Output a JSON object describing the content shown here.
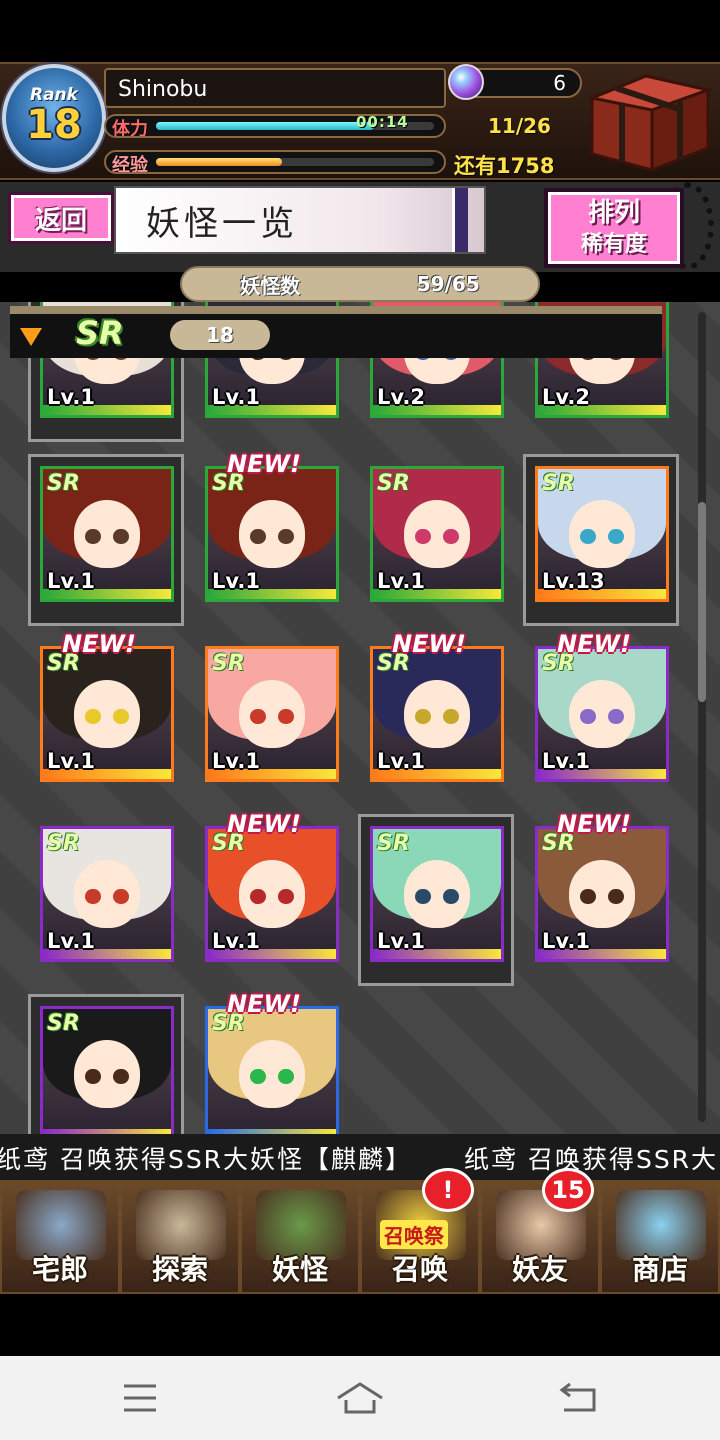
{
  "player": {
    "rank_label": "Rank",
    "rank": "18",
    "name": "Shinobu",
    "stamina_label": "体力",
    "stamina_timer": "00:14",
    "stamina_fill": 0.78,
    "stamina_count": "11/26",
    "xp_label": "经验",
    "xp_fill": 0.45,
    "xp_remaining": "还有1758",
    "gems": "6"
  },
  "titlebar": {
    "back_label": "返回",
    "title": "妖怪一览",
    "sort_label": "排列",
    "sort_value": "稀有度"
  },
  "yokai_count": {
    "label": "妖怪数",
    "value": "59/65"
  },
  "section": {
    "rarity": "SR",
    "count": "18"
  },
  "cards": [
    {
      "level": "Lv.1",
      "new": false,
      "sr": false,
      "framed": true,
      "rarity_color": "#2aa83a",
      "hair": "#e8e0d8",
      "eye": "#6a4a2a"
    },
    {
      "level": "Lv.1",
      "new": false,
      "sr": false,
      "framed": false,
      "rarity_color": "#2aa83a",
      "hair": "#2a2a3a",
      "eye": "#3a2a1a"
    },
    {
      "level": "Lv.2",
      "new": false,
      "sr": false,
      "framed": false,
      "rarity_color": "#2aa83a",
      "hair": "#e05a6a",
      "eye": "#3a6aaa"
    },
    {
      "level": "Lv.2",
      "new": false,
      "sr": false,
      "framed": false,
      "rarity_color": "#2aa83a",
      "hair": "#8a2a2a",
      "eye": "#4a2a1a"
    },
    {
      "level": "Lv.1",
      "new": false,
      "sr": true,
      "framed": true,
      "rarity_color": "#2aa83a",
      "hair": "#7a2418",
      "eye": "#5a3a2a"
    },
    {
      "level": "Lv.1",
      "new": true,
      "sr": true,
      "framed": false,
      "rarity_color": "#2aa83a",
      "hair": "#7a2418",
      "eye": "#5a3a2a"
    },
    {
      "level": "Lv.1",
      "new": false,
      "sr": true,
      "framed": false,
      "rarity_color": "#2aa83a",
      "hair": "#b02a4a",
      "eye": "#d03a6a"
    },
    {
      "level": "Lv.13",
      "new": false,
      "sr": true,
      "framed": true,
      "rarity_color": "#ff7a1a",
      "hair": "#c8d8ec",
      "eye": "#3aa8c8"
    },
    {
      "level": "Lv.1",
      "new": true,
      "sr": true,
      "framed": false,
      "rarity_color": "#ff7a1a",
      "hair": "#2a221c",
      "eye": "#e8c82a"
    },
    {
      "level": "Lv.1",
      "new": false,
      "sr": true,
      "framed": false,
      "rarity_color": "#ff7a1a",
      "hair": "#f8a8a0",
      "eye": "#c83a2a"
    },
    {
      "level": "Lv.1",
      "new": true,
      "sr": true,
      "framed": false,
      "rarity_color": "#ff7a1a",
      "hair": "#2a2a5a",
      "eye": "#c8a82a"
    },
    {
      "level": "Lv.1",
      "new": true,
      "sr": true,
      "framed": false,
      "rarity_color": "#8a2ac8",
      "hair": "#a8d8c8",
      "eye": "#8a6ac8"
    },
    {
      "level": "Lv.1",
      "new": false,
      "sr": true,
      "framed": false,
      "rarity_color": "#8a2ac8",
      "hair": "#e8e4e0",
      "eye": "#c83a2a"
    },
    {
      "level": "Lv.1",
      "new": true,
      "sr": true,
      "framed": false,
      "rarity_color": "#8a2ac8",
      "hair": "#e8502a",
      "eye": "#b82a2a"
    },
    {
      "level": "Lv.1",
      "new": false,
      "sr": true,
      "framed": true,
      "rarity_color": "#8a2ac8",
      "hair": "#8ad8b8",
      "eye": "#2a4a6a"
    },
    {
      "level": "Lv.1",
      "new": true,
      "sr": true,
      "framed": false,
      "rarity_color": "#8a2ac8",
      "hair": "#8a5a3a",
      "eye": "#4a2a1a"
    },
    {
      "level": "",
      "new": false,
      "sr": true,
      "framed": true,
      "rarity_color": "#8a2ac8",
      "hair": "#1a1a1a",
      "eye": "#4a2a1a"
    },
    {
      "level": "",
      "new": true,
      "sr": true,
      "framed": false,
      "rarity_color": "#2a6ae8",
      "hair": "#e8c880",
      "eye": "#2ab84a"
    }
  ],
  "new_label": "NEW!",
  "ticker": {
    "text1": "纸鸢 召唤获得SSR大妖怪【麒麟】",
    "text2": "纸鸢 召唤获得SSR大"
  },
  "bottom_nav": [
    {
      "label": "宅郎",
      "icon": "house-icon",
      "badge": ""
    },
    {
      "label": "探索",
      "icon": "magnifier-icon",
      "badge": ""
    },
    {
      "label": "妖怪",
      "icon": "scroll-icon",
      "badge": ""
    },
    {
      "label": "召唤",
      "icon": "summon-icon",
      "badge": "!",
      "sub": "召唤祭"
    },
    {
      "label": "妖友",
      "icon": "friend-icon",
      "badge": "15"
    },
    {
      "label": "商店",
      "icon": "orb-icon",
      "badge": ""
    }
  ],
  "colors": {
    "accent_pink": "#ff7fd0",
    "gold_text": "#ffe24a",
    "sr_green": "#2aa83a"
  }
}
